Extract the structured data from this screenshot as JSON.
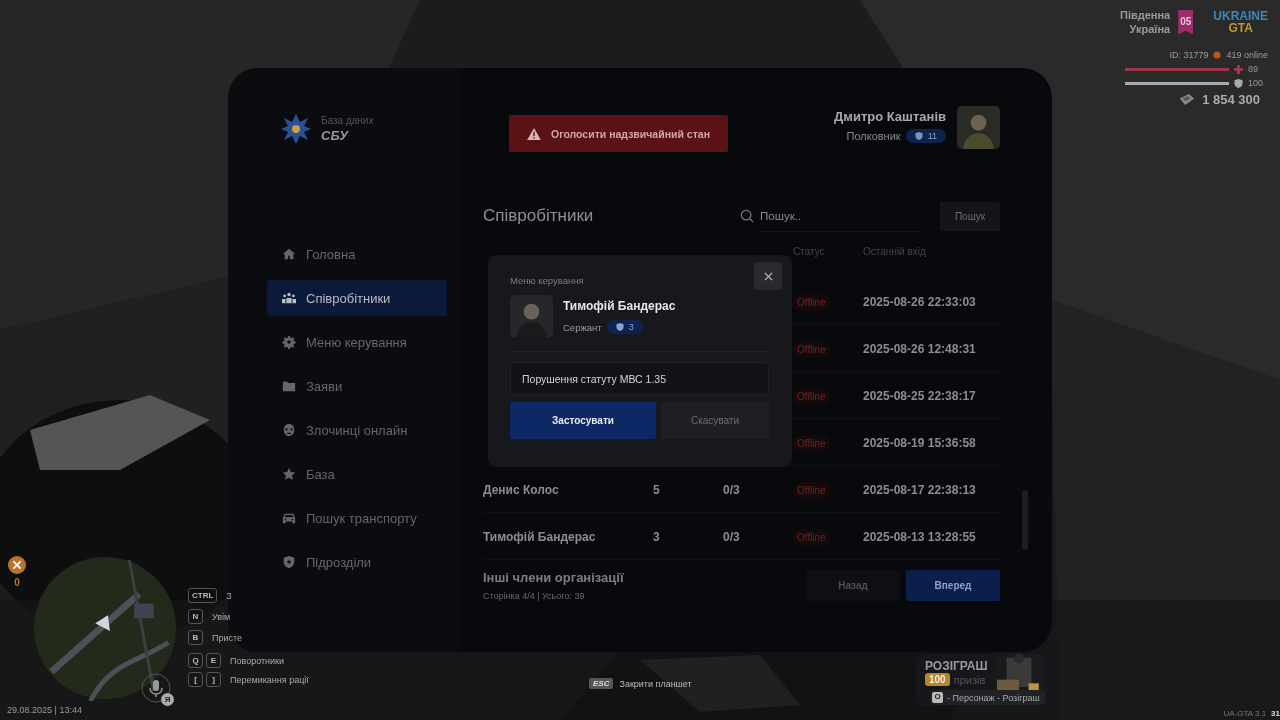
{
  "hud": {
    "server_name": "Південна Україна",
    "server_number": "05",
    "logo_top": "UKRAINE",
    "logo_bottom": "GTA",
    "player_id": "ID: 31779",
    "online": "419 online",
    "health": {
      "level": 1,
      "value": "89"
    },
    "armor": {
      "level": 1,
      "value": "100"
    },
    "money": "1 854 300",
    "food_count": "0",
    "voice_badge": "Я",
    "datetime": "29.08.2025 | 13:44",
    "hotkeys": [
      {
        "keys": [
          "CTRL"
        ],
        "label": "З"
      },
      {
        "keys": [
          "N"
        ],
        "label": "Увім"
      },
      {
        "keys": [
          "B"
        ],
        "label": "Присте"
      },
      {
        "keys": [
          "Q",
          "E"
        ],
        "label": "Поворотники"
      },
      {
        "keys": [
          "[",
          "]"
        ],
        "label": "Перемикання рації"
      }
    ],
    "close_hint": {
      "key": "ESC",
      "label": "Закрити планшет"
    },
    "giveaway": {
      "title": "РОЗІГРАШ",
      "count": "100",
      "unit": "призів",
      "key": "O",
      "hint": "- Персонаж - Розіграш"
    },
    "version": "UA-GTA 3.1",
    "fps": "31"
  },
  "tablet": {
    "brand_caption": "База даних",
    "brand": "СБУ",
    "emergency_button": "Оголосити надзвичайний стан",
    "user": {
      "name": "Дмитро Каштанів",
      "rank": "Полковник",
      "rank_level": "11"
    },
    "sidebar": {
      "items": [
        {
          "kind": "home",
          "label": "Головна",
          "selected": false
        },
        {
          "kind": "users",
          "label": "Співробітники",
          "selected": true
        },
        {
          "kind": "gear",
          "label": "Меню керування",
          "selected": false
        },
        {
          "kind": "folder",
          "label": "Заяви",
          "selected": false
        },
        {
          "kind": "mask",
          "label": "Злочинці онлайн",
          "selected": false
        },
        {
          "kind": "star",
          "label": "База",
          "selected": false
        },
        {
          "kind": "car",
          "label": "Пошук транспорту",
          "selected": false
        },
        {
          "kind": "shield",
          "label": "Підрозділи",
          "selected": false
        }
      ]
    },
    "title": "Співробітники",
    "search": {
      "placeholder": "Пошук.."
    },
    "search_button": "Пошук",
    "table": {
      "columns": [
        "Статус",
        "Останній вхід"
      ],
      "rows": [
        {
          "status": "Offline",
          "online": false,
          "last_login": "2025-08-26 22:33:03"
        },
        {
          "status": "Offline",
          "online": false,
          "last_login": "2025-08-26 12:48:31"
        },
        {
          "status": "Offline",
          "online": false,
          "last_login": "2025-08-25 22:38:17"
        },
        {
          "status": "Offline",
          "online": false,
          "last_login": "2025-08-19 15:36:58"
        },
        {
          "name": "Денис Колос",
          "rank": "5",
          "warnings": "0/3",
          "status": "Offline",
          "online": false,
          "last_login": "2025-08-17 22:38:13"
        },
        {
          "name": "Тимофій Бандерас",
          "rank": "3",
          "warnings": "0/3",
          "status": "Offline",
          "online": false,
          "last_login": "2025-08-13 13:28:55"
        }
      ]
    },
    "footer": {
      "title": "Інші члени організації",
      "pagination": "Сторінка 4/4 | Усього: 39",
      "prev_button": "Назад",
      "next_button": "Вперед"
    },
    "modal": {
      "title": "Меню керування",
      "name": "Тимофій Бандерас",
      "rank": "Сержант",
      "rank_level": "3",
      "reason": "Порушення статуту МВС 1.35",
      "apply_button": "Застосувати",
      "cancel_button": "Скасувати"
    }
  }
}
